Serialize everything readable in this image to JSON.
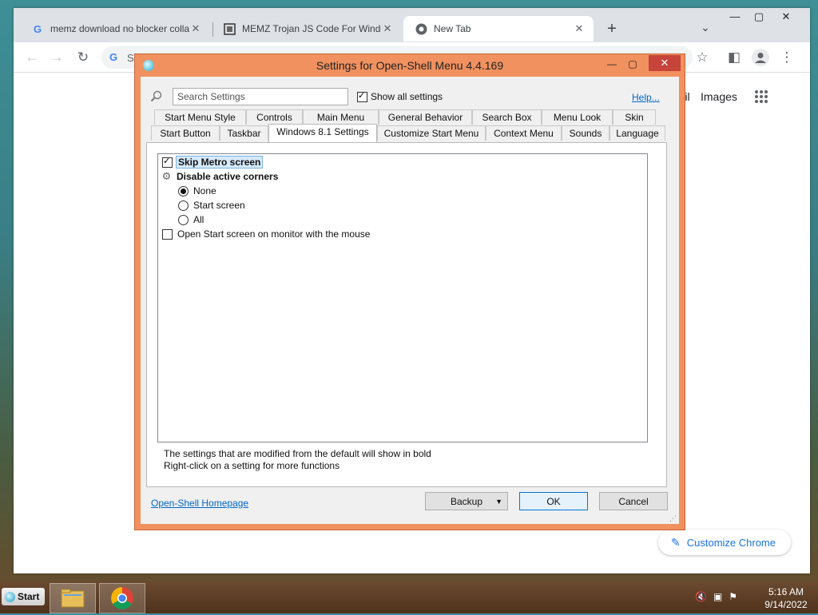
{
  "browser": {
    "tabs": [
      {
        "title": "memz download no blocker colla"
      },
      {
        "title": "MEMZ Trojan JS Code For Windo"
      },
      {
        "title": "New Tab"
      }
    ],
    "omnibox_text": "S",
    "ntp": {
      "gmail": "mail",
      "images": "Images"
    },
    "customize_label": "Customize Chrome"
  },
  "dialog": {
    "title": "Settings for Open-Shell Menu 4.4.169",
    "search_placeholder": "Search Settings",
    "show_all_label": "Show all settings",
    "show_all_checked": true,
    "help_label": "Help...",
    "tabs_row1": [
      "Start Menu Style",
      "Controls",
      "Main Menu",
      "General Behavior",
      "Search Box",
      "Menu Look",
      "Skin"
    ],
    "tabs_row2": [
      "Start Button",
      "Taskbar",
      "Windows 8.1 Settings",
      "Customize Start Menu",
      "Context Menu",
      "Sounds",
      "Language"
    ],
    "active_tab": "Windows 8.1 Settings",
    "settings": {
      "skip_metro": "Skip Metro screen",
      "disable_corners": "Disable active corners",
      "corner_none": "None",
      "corner_start": "Start screen",
      "corner_all": "All",
      "open_start_monitor": "Open Start screen on monitor with the mouse"
    },
    "hint_bold": "The settings that are modified from the default will show in bold",
    "hint_rightclick": "Right-click on a setting for more functions",
    "homepage_label": "Open-Shell Homepage",
    "backup_label": "Backup",
    "ok_label": "OK",
    "cancel_label": "Cancel"
  },
  "taskbar": {
    "start_label": "Start",
    "time": "5:16 AM",
    "date": "9/14/2022"
  },
  "colors": {
    "dialog_frame": "#f0915f",
    "link": "#0066cc",
    "chrome_accent": "#1a73e8"
  }
}
